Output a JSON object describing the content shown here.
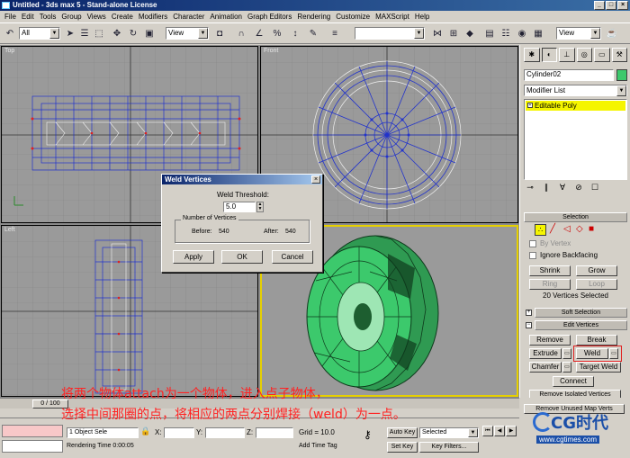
{
  "window": {
    "title": "Untitled - 3ds max 5 - Stand-alone License"
  },
  "menu": [
    "File",
    "Edit",
    "Tools",
    "Group",
    "Views",
    "Create",
    "Modifiers",
    "Character",
    "Animation",
    "Graph Editors",
    "Rendering",
    "Customize",
    "MAXScript",
    "Help"
  ],
  "toolbar": {
    "selection_filter": "All",
    "ref_coord": "View",
    "named_selection": "",
    "ref_coord_right": "View"
  },
  "viewports": {
    "top": {
      "label": "Top"
    },
    "front": {
      "label": "Front"
    },
    "left": {
      "label": "Left"
    },
    "perspective": {
      "label": ""
    }
  },
  "panel": {
    "object_name": "Cylinder02",
    "object_color": "#3cc96c",
    "modifier_list": "Modifier List",
    "stack_item": "Editable Poly",
    "selection_title": "Selection",
    "by_vertex": "By Vertex",
    "ignore_backfacing": "Ignore Backfacing",
    "shrink": "Shrink",
    "grow": "Grow",
    "ring": "Ring",
    "loop": "Loop",
    "selected_status": "20 Vertices Selected",
    "soft_selection": "Soft Selection",
    "edit_vertices": "Edit Vertices",
    "remove": "Remove",
    "break": "Break",
    "extrude": "Extrude",
    "weld": "Weld",
    "chamfer": "Chamfer",
    "target_weld": "Target Weld",
    "connect": "Connect",
    "remove_isolated": "Remove Isolated Vertices",
    "remove_unused": "Remove Unused Map Verts"
  },
  "dialog": {
    "title": "Weld Vertices",
    "threshold_label": "Weld Threshold:",
    "threshold_value": "5.0",
    "group_label": "Number of Vertices",
    "before_label": "Before:",
    "before_value": "540",
    "after_label": "After:",
    "after_value": "540",
    "apply": "Apply",
    "ok": "OK",
    "cancel": "Cancel"
  },
  "timeline": {
    "frame": "0 / 100"
  },
  "status": {
    "selection": "1 Object Sele",
    "x_label": "X:",
    "y_label": "Y:",
    "z_label": "Z:",
    "grid": "Grid = 10.0",
    "auto_key": "Auto Key",
    "key_mode": "Selected",
    "set_key": "Set Key",
    "key_filters": "Key Filters...",
    "render_time": "Rendering Time  0:00:05",
    "add_time_tag": "Add Time Tag"
  },
  "annotation": {
    "line1": "将两个物体attach为一个物体，进入点子物体，",
    "line2": "选择中间那圈的点，将相应的两点分别焊接（weld）为一点。"
  },
  "watermark": {
    "brand": "CG时代",
    "url": "www.cgtimes.com"
  },
  "colors": {
    "wire_blue": "#2233cc",
    "wire_white": "#f0f0f0",
    "wheel_green": "#3cc96c",
    "selected_red": "#e02020",
    "active_viewport": "#e6d000"
  }
}
